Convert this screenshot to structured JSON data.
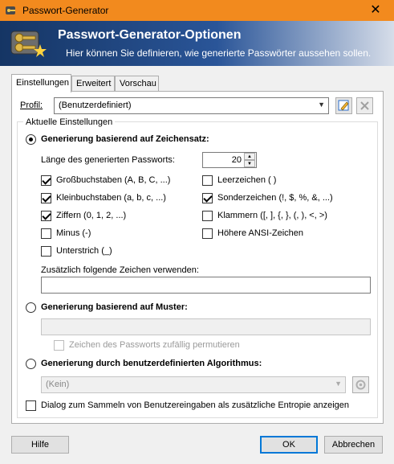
{
  "window": {
    "title": "Passwort-Generator",
    "close_glyph": "✕"
  },
  "banner": {
    "title": "Passwort-Generator-Optionen",
    "subtitle": "Hier können Sie definieren, wie generierte Passwörter aussehen sollen."
  },
  "tabs": [
    {
      "label": "Einstellungen",
      "active": true
    },
    {
      "label": "Erweitert",
      "active": false
    },
    {
      "label": "Vorschau",
      "active": false
    }
  ],
  "profile": {
    "label": "Profil:",
    "value": "(Benutzerdefiniert)"
  },
  "current_settings_label": "Aktuelle Einstellungen",
  "charset_mode": {
    "label": "Generierung basierend auf Zeichensatz:",
    "selected": true,
    "length_label": "Länge des generierten Passworts:",
    "length_value": "20",
    "options": [
      {
        "label": "Großbuchstaben (A, B, C, ...)",
        "checked": true
      },
      {
        "label": "Leerzeichen ( )",
        "checked": false
      },
      {
        "label": "Kleinbuchstaben (a, b, c, ...)",
        "checked": true
      },
      {
        "label": "Sonderzeichen (!, $, %, &, ...)",
        "checked": true
      },
      {
        "label": "Ziffern (0, 1, 2, ...)",
        "checked": true
      },
      {
        "label": "Klammern ([, ], {, }, (, ), <, >)",
        "checked": false
      },
      {
        "label": "Minus (-)",
        "checked": false
      },
      {
        "label": "Höhere ANSI-Zeichen",
        "checked": false
      },
      {
        "label": "Unterstrich (_)",
        "checked": false
      }
    ],
    "extra_chars_label": "Zusätzlich folgende Zeichen verwenden:",
    "extra_chars_value": ""
  },
  "pattern_mode": {
    "label": "Generierung basierend auf Muster:",
    "selected": false,
    "pattern_value": "",
    "permute_label": "Zeichen des Passworts zufällig permutieren",
    "permute_checked": false
  },
  "algorithm_mode": {
    "label": "Generierung durch benutzerdefinierten Algorithmus:",
    "selected": false,
    "combo_value": "(Kein)"
  },
  "entropy": {
    "label": "Dialog zum Sammeln von Benutzereingaben als zusätzliche Entropie anzeigen",
    "checked": false
  },
  "buttons": {
    "help": "Hilfe",
    "ok": "OK",
    "cancel": "Abbrechen"
  },
  "colors": {
    "titlebar": "#f28a1e",
    "banner_dark": "#153564",
    "default_button_border": "#0078d7"
  },
  "icons": [
    "key-icon",
    "close-icon",
    "edit-profile-icon",
    "delete-profile-icon",
    "gear-icon",
    "chevron-down-icon"
  ]
}
